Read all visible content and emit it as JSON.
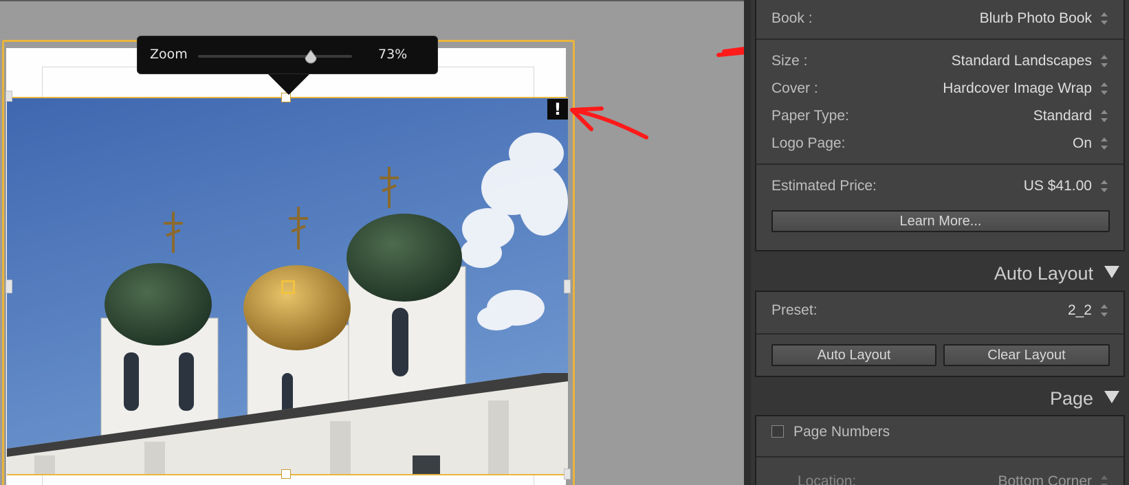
{
  "zoom": {
    "label": "Zoom",
    "value_text": "73%",
    "value": 73
  },
  "canvas": {
    "warning_glyph": "!"
  },
  "book_settings": {
    "book": {
      "label": "Book :",
      "value": "Blurb Photo Book"
    },
    "size": {
      "label": "Size :",
      "value": "Standard Landscapes"
    },
    "cover": {
      "label": "Cover :",
      "value": "Hardcover Image Wrap"
    },
    "paper_type": {
      "label": "Paper Type:",
      "value": "Standard"
    },
    "logo_page": {
      "label": "Logo Page:",
      "value": "On"
    },
    "estimated_price": {
      "label": "Estimated Price:",
      "value": "US $41.00"
    },
    "learn_more_label": "Learn More..."
  },
  "auto_layout": {
    "title": "Auto Layout",
    "preset": {
      "label": "Preset:",
      "value": "2_2"
    },
    "auto_layout_button": "Auto Layout",
    "clear_layout_button": "Clear Layout"
  },
  "page": {
    "title": "Page",
    "page_numbers_label": "Page Numbers",
    "page_numbers_checked": false,
    "location": {
      "label": "Location:",
      "value": "Bottom Corner"
    }
  },
  "colors": {
    "selection": "#e9b53a",
    "panel": "#424242",
    "annotation": "#ff1a1a"
  }
}
